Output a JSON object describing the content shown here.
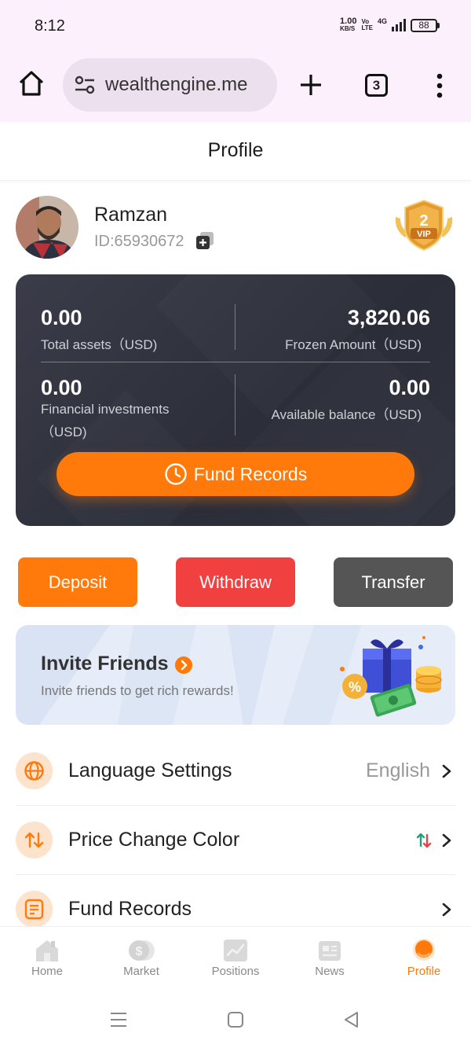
{
  "status_bar": {
    "time": "8:12",
    "speed_value": "1.00",
    "speed_unit": "KB/S",
    "volte": "Vo\nLTE",
    "network": "4G",
    "battery": "88"
  },
  "browser": {
    "url": "wealthengine.me",
    "tab_count": "3"
  },
  "page": {
    "title": "Profile"
  },
  "user": {
    "name": "Ramzan",
    "id_text": "ID:65930672",
    "vip_level": "2",
    "vip_text": "VIP"
  },
  "assets": {
    "total_assets_value": "0.00",
    "total_assets_label": "Total assets（USD)",
    "frozen_value": "3,820.06",
    "frozen_label": "Frozen Amount（USD)",
    "financial_value": "0.00",
    "financial_label_1": "Financial investments",
    "financial_label_2": "（USD)",
    "available_value": "0.00",
    "available_label": "Available balance（USD)",
    "fund_records_label": "Fund Records"
  },
  "actions": {
    "deposit": "Deposit",
    "withdraw": "Withdraw",
    "transfer": "Transfer"
  },
  "invite": {
    "title": "Invite Friends",
    "subtitle": "Invite friends to get rich rewards!"
  },
  "settings": {
    "language_label": "Language Settings",
    "language_value": "English",
    "price_color_label": "Price Change Color",
    "fund_records_label": "Fund Records"
  },
  "nav": {
    "home": "Home",
    "market": "Market",
    "positions": "Positions",
    "news": "News",
    "profile": "Profile"
  },
  "colors": {
    "accent": "#ff7a0a",
    "withdraw": "#f04140",
    "transfer": "#555555",
    "card": "#2f313c"
  }
}
